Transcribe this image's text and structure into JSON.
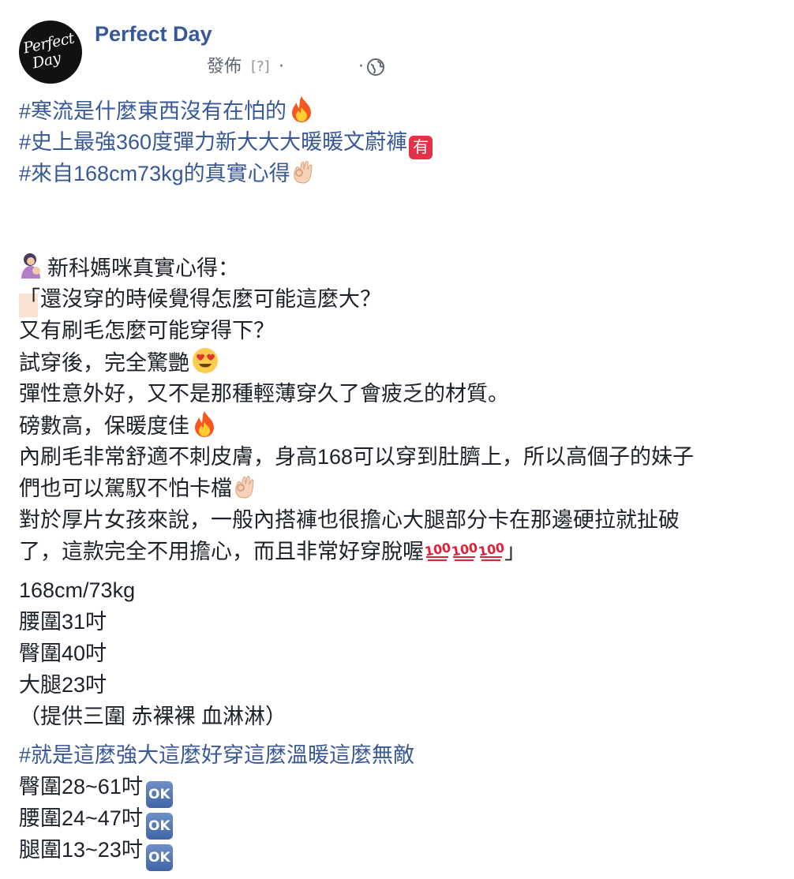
{
  "header": {
    "page_name": "Perfect Day",
    "avatar_text_1": "Perfect",
    "avatar_text_2": "Day",
    "published_label": "發佈",
    "help_label": "[?]",
    "separator": "·"
  },
  "post": {
    "hashtag_1": "#寒流是什麼東西沒有在怕的",
    "hashtag_2": "#史上最強360度彈力新大大大暖暖文蔚褲",
    "hashtag_2_badge": "有",
    "hashtag_3": "#來自168cm73kg的真實心得",
    "intro": "新科媽咪真實心得：",
    "q1": "「還沒穿的時候覺得怎麼可能這麼大？",
    "q2": "又有刷毛怎麼可能穿得下？",
    "q3": "試穿後，完全驚艷",
    "q4": "彈性意外好，又不是那種輕薄穿久了會疲乏的材質。",
    "q5": "磅數高，保暖度佳",
    "q6": "內刷毛非常舒適不刺皮膚，身高168可以穿到肚臍上，所以高個子的妹子",
    "q7": "們也可以駕馭不怕卡檔",
    "q8": "對於厚片女孩來說，一般內搭褲也很擔心大腿部分卡在那邊硬拉就扯破",
    "q9": "了，這款完全不用擔心，而且非常好穿脫喔",
    "q9_end": "」",
    "stats_1": "168cm/73kg",
    "stats_2": "腰圍31吋",
    "stats_3": "臀圍40吋",
    "stats_4": "大腿23吋",
    "stats_5": "（提供三圍 赤裸裸 血淋淋）",
    "hashtag_4": "#就是這麼強大這麼好穿這麼溫暖這麼無敵",
    "size_1": "臀圍28~61吋",
    "size_2": "腰圍24~47吋",
    "size_3": "腿圍13~23吋",
    "ok_badge": "OK"
  },
  "colors": {
    "page_name": "#365899",
    "hashtag": "#385898",
    "meta": "#606770"
  },
  "icons": [
    "globe-icon",
    "fire-icon",
    "you-badge-icon",
    "ok-hand-icon",
    "mother-nursing-icon",
    "heart-eyes-icon",
    "hundred-icon",
    "ok-button-icon"
  ]
}
